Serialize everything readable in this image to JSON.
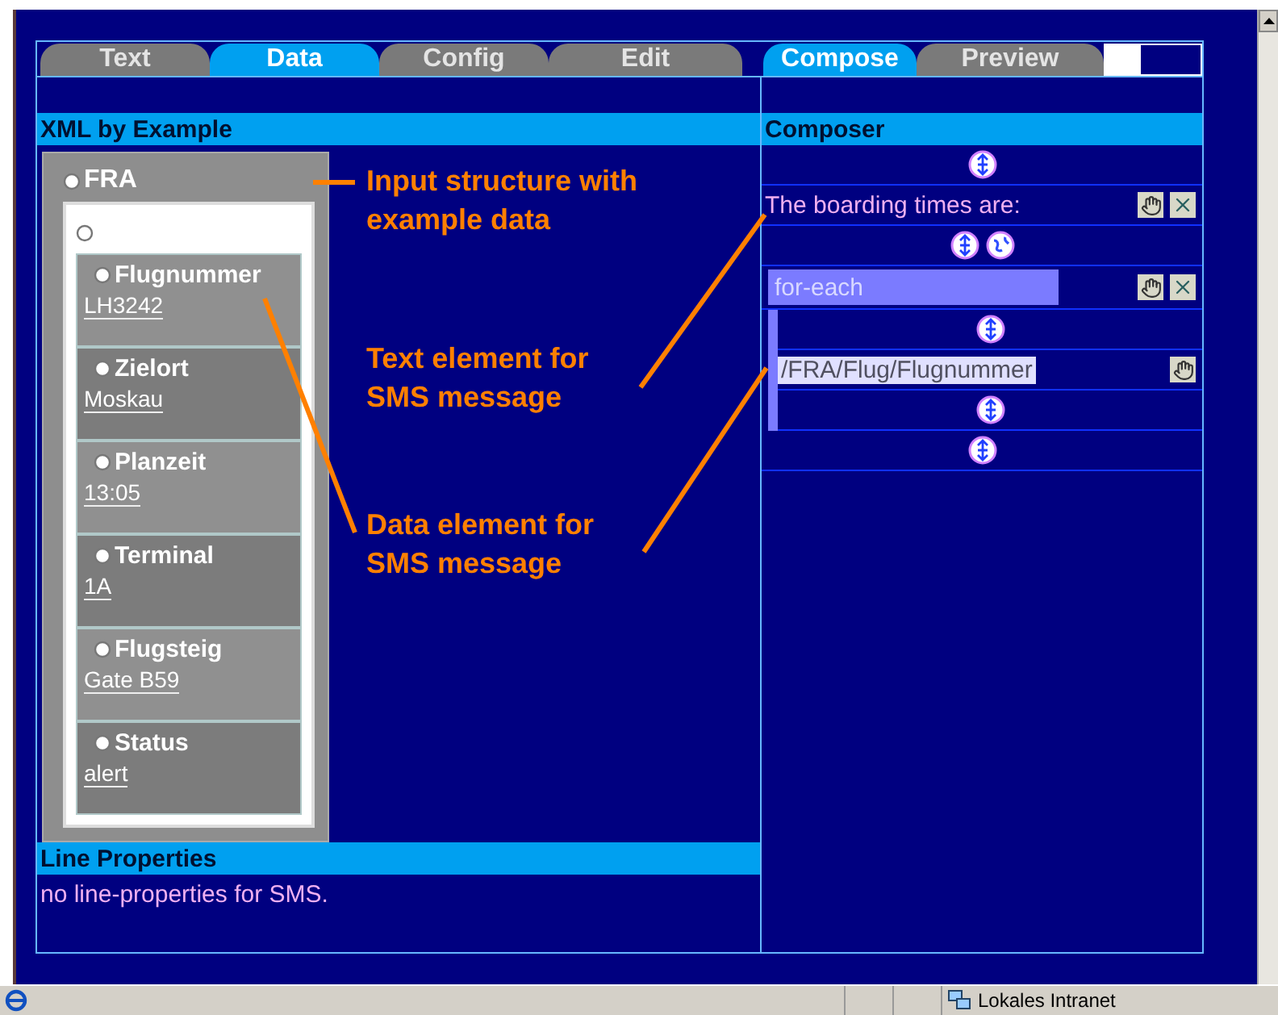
{
  "tabs_left": [
    {
      "label": "Text",
      "selected": false
    },
    {
      "label": "Data",
      "selected": true
    },
    {
      "label": "Config",
      "selected": false
    },
    {
      "label": "Edit",
      "selected": false
    }
  ],
  "tabs_right": [
    {
      "label": "Compose",
      "selected": true
    },
    {
      "label": "Preview",
      "selected": false
    }
  ],
  "xml_panel": {
    "title": "XML by Example",
    "root": "FRA",
    "fields": [
      {
        "name": "Flugnummer",
        "value": "LH3242"
      },
      {
        "name": "Zielort",
        "value": "Moskau"
      },
      {
        "name": "Planzeit",
        "value": "13:05"
      },
      {
        "name": "Terminal",
        "value": "1A"
      },
      {
        "name": "Flugsteig",
        "value": "Gate B59"
      },
      {
        "name": "Status",
        "value": "alert"
      }
    ]
  },
  "line_properties": {
    "title": "Line Properties",
    "text": "no line-properties for SMS."
  },
  "composer": {
    "title": "Composer",
    "rows": [
      {
        "kind": "insert"
      },
      {
        "kind": "text",
        "text": "The boarding times are:",
        "movable": true,
        "deletable": true
      },
      {
        "kind": "insert_query"
      },
      {
        "kind": "loop",
        "text": "for-each",
        "movable": true,
        "deletable": true,
        "children": [
          {
            "kind": "insert"
          },
          {
            "kind": "data",
            "text": "/FRA/Flug/Flugnummer",
            "movable": true,
            "deletable": false
          },
          {
            "kind": "insert"
          }
        ]
      },
      {
        "kind": "insert"
      }
    ]
  },
  "annotations": [
    "Input structure with\nexample data",
    "Text element for\nSMS message",
    "Data element for\nSMS message"
  ],
  "status_bar": {
    "zone": "Lokales Intranet"
  }
}
